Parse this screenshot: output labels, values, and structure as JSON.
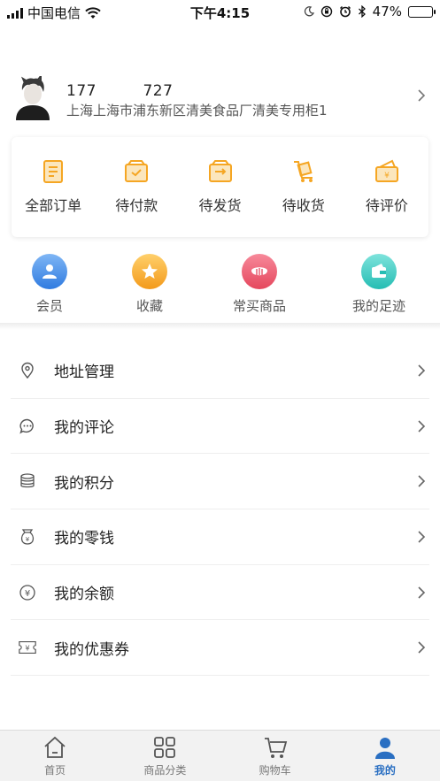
{
  "status_bar": {
    "carrier": "中国电信",
    "time": "下午4:15",
    "battery": "47%",
    "battery_level": 0.47,
    "icons": [
      "signal-icon",
      "wifi-icon",
      "moon-icon",
      "lock-rotation-icon",
      "alarm-icon",
      "bluetooth-icon",
      "battery-icon"
    ]
  },
  "profile": {
    "phone": "177　　　727",
    "address": "上海上海市浦东新区清美食品厂清美专用柜1",
    "avatar_icon": "avatar"
  },
  "orders": {
    "items": [
      {
        "label": "全部订单",
        "icon": "all-orders-icon"
      },
      {
        "label": "待付款",
        "icon": "pending-payment-icon"
      },
      {
        "label": "待发货",
        "icon": "pending-shipment-icon"
      },
      {
        "label": "待收货",
        "icon": "pending-receipt-icon"
      },
      {
        "label": "待评价",
        "icon": "pending-review-icon"
      }
    ],
    "accent_color": "#f5a623"
  },
  "quick": {
    "items": [
      {
        "label": "会员",
        "icon": "member-icon",
        "color": "#3d8ae8"
      },
      {
        "label": "收藏",
        "icon": "favorite-icon",
        "color": "#f4a425"
      },
      {
        "label": "常买商品",
        "icon": "frequent-items-icon",
        "color": "#ec5a6c"
      },
      {
        "label": "我的足迹",
        "icon": "footprint-icon",
        "color": "#3cc9c1"
      }
    ]
  },
  "menu": {
    "items": [
      {
        "label": "地址管理",
        "icon": "location-icon"
      },
      {
        "label": "我的评论",
        "icon": "comment-icon"
      },
      {
        "label": "我的积分",
        "icon": "points-icon"
      },
      {
        "label": "我的零钱",
        "icon": "change-icon"
      },
      {
        "label": "我的余额",
        "icon": "balance-icon"
      },
      {
        "label": "我的优惠券",
        "icon": "coupon-icon"
      }
    ]
  },
  "tabbar": {
    "items": [
      {
        "label": "首页",
        "icon": "home-icon"
      },
      {
        "label": "商品分类",
        "icon": "category-icon"
      },
      {
        "label": "购物车",
        "icon": "cart-icon"
      },
      {
        "label": "我的",
        "icon": "profile-icon"
      }
    ],
    "active": "我的",
    "active_color": "#2a6fc2"
  }
}
